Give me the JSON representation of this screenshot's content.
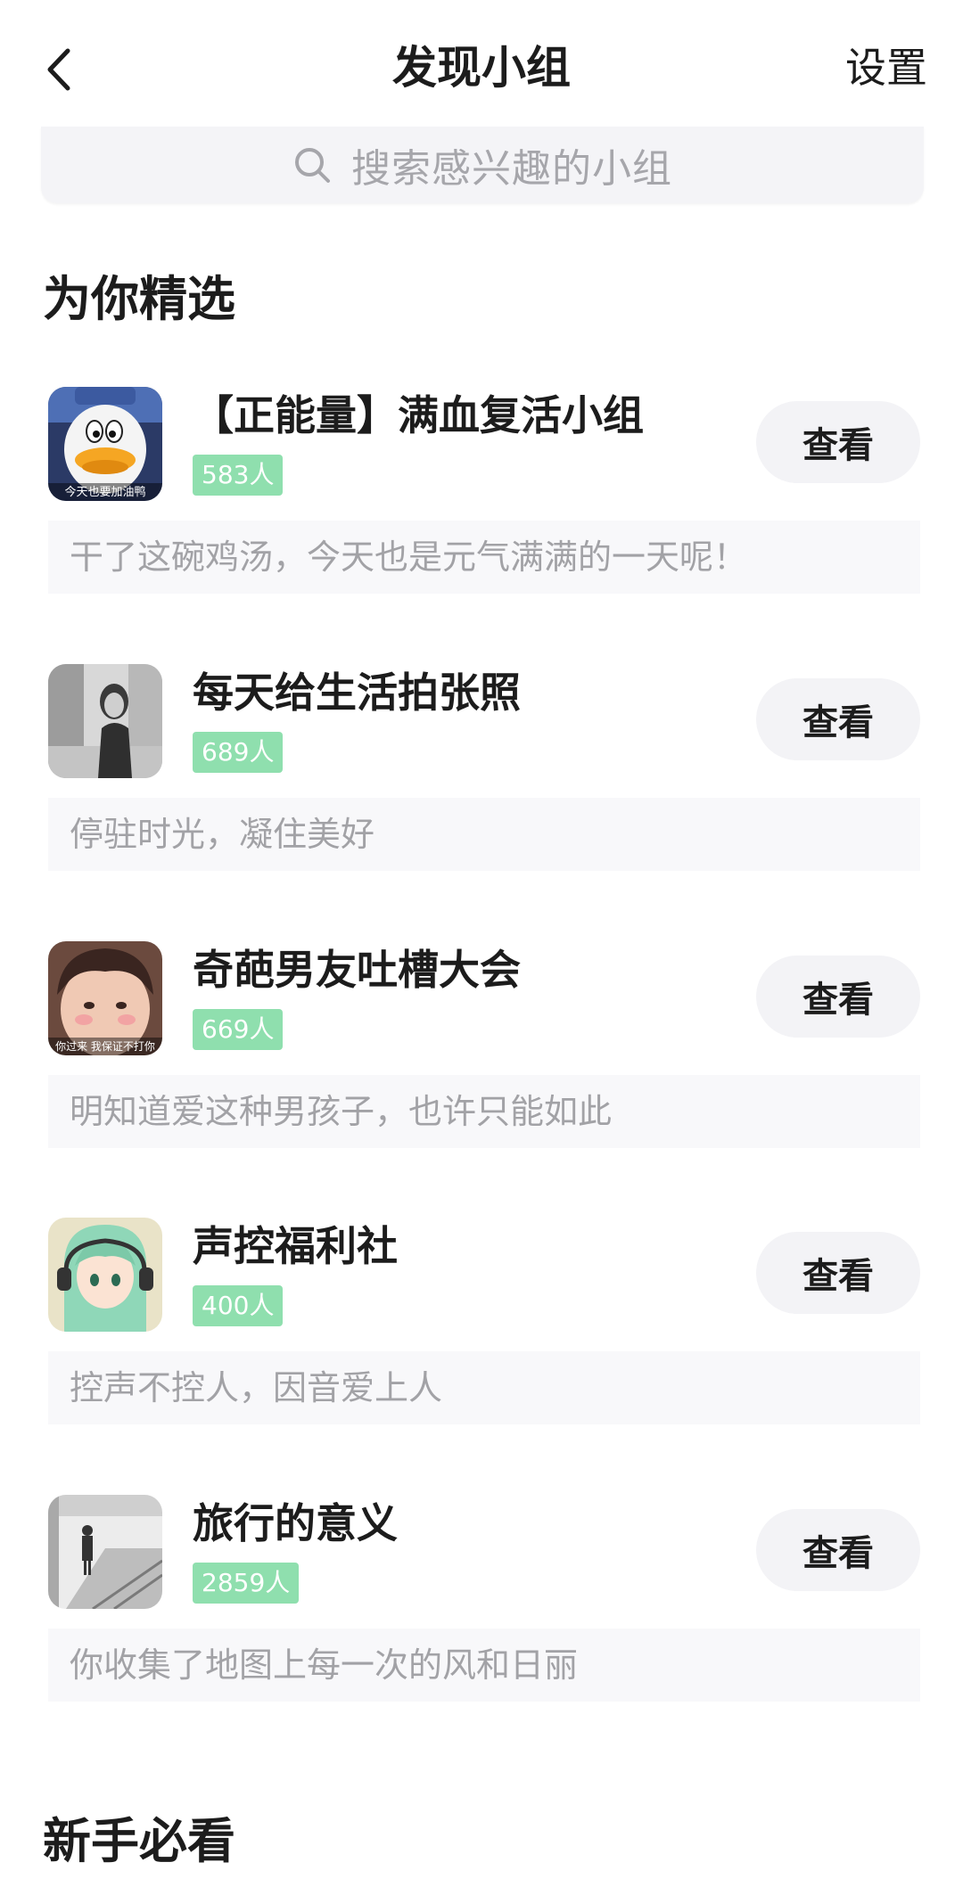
{
  "nav": {
    "back_icon": "chevron-left-icon",
    "title": "发现小组",
    "settings_label": "设置"
  },
  "search": {
    "icon": "search-icon",
    "placeholder": "搜索感兴趣的小组"
  },
  "featured": {
    "title": "为你精选",
    "groups": [
      {
        "name": "【正能量】满血复活小组",
        "count": "583人",
        "button": "查看",
        "description": "干了这碗鸡汤，今天也是元气满满的一天呢！",
        "avatar_caption": "今天也要加油鸭"
      },
      {
        "name": "每天给生活拍张照",
        "count": "689人",
        "button": "查看",
        "description": "停驻时光，凝住美好"
      },
      {
        "name": "奇葩男友吐槽大会",
        "count": "669人",
        "button": "查看",
        "description": "明知道爱这种男孩子，也许只能如此",
        "avatar_caption": "你过来 我保证不打你"
      },
      {
        "name": "声控福利社",
        "count": "400人",
        "button": "查看",
        "description": "控声不控人，因音爱上人"
      },
      {
        "name": "旅行的意义",
        "count": "2859人",
        "button": "查看",
        "description": "你收集了地图上每一次的风和日丽"
      }
    ]
  },
  "newbie": {
    "title": "新手必看"
  },
  "colors": {
    "count_badge_bg": "#8fdfae",
    "button_bg": "#f3f3f6",
    "desc_bg": "#f8f8fa",
    "desc_text": "#a2a2a6"
  }
}
